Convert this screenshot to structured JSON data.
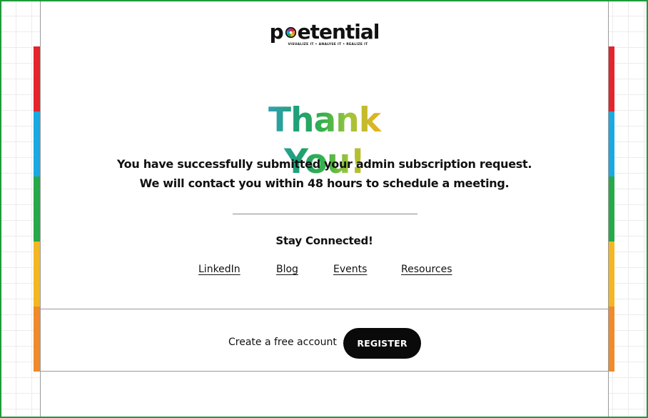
{
  "colors": {
    "frame_border": "#1f9a3a",
    "stripe_red": "#e5242b",
    "stripe_blue": "#19a9e3",
    "stripe_green": "#27a94a",
    "stripe_yellow": "#f4b722",
    "stripe_orange": "#f08a2a",
    "button_bg": "#0a0a0a"
  },
  "logo": {
    "name_prefix": "p",
    "name_suffix": "etential",
    "tagline": "VISUALIZE IT • ANALYSE IT • REALIZE IT",
    "mark_icon": "color-wheel-icon"
  },
  "headline": "Thank You!",
  "message": {
    "line1": "You have successfully submitted your admin subscription request.",
    "line2": "We will contact you within 48 hours to schedule a meeting."
  },
  "stay_connected": "Stay Connected!",
  "links": {
    "linkedin": "LinkedIn",
    "blog": "Blog",
    "events": "Events",
    "resources": "Resources"
  },
  "footer": {
    "prompt": "Create a free account",
    "register_label": "REGISTER"
  }
}
